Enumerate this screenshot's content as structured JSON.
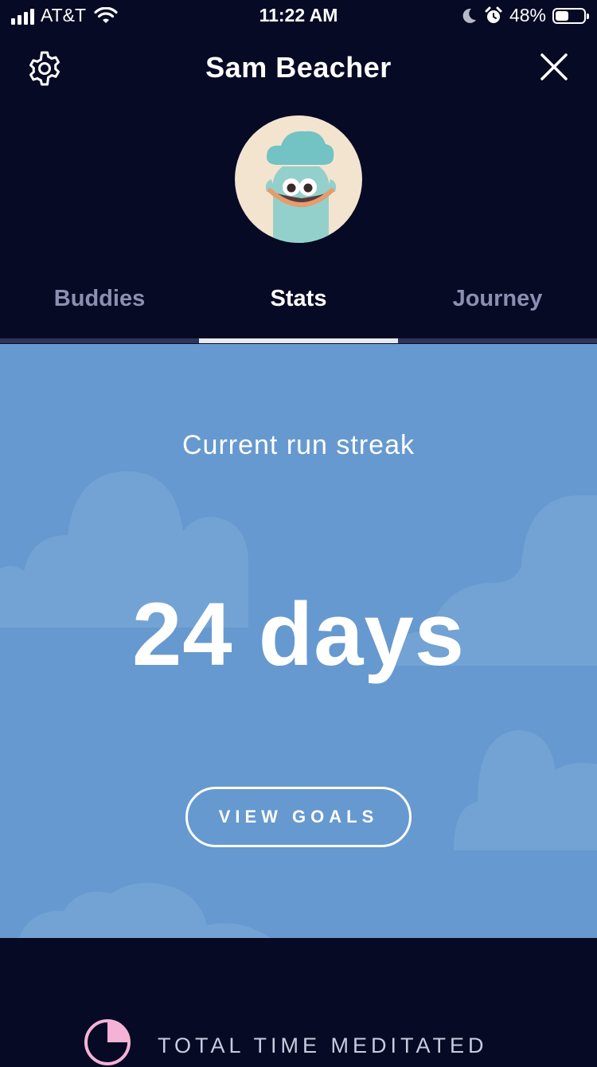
{
  "status_bar": {
    "carrier": "AT&T",
    "time": "11:22 AM",
    "battery_percent": "48%",
    "battery_level": 0.48,
    "icons": [
      "signal-icon",
      "wifi-icon",
      "moon-icon",
      "alarm-icon",
      "battery-icon"
    ]
  },
  "header": {
    "title": "Sam Beacher",
    "left_icon": "gear-icon",
    "right_icon": "close-icon"
  },
  "tabs": [
    {
      "label": "Buddies",
      "active": false
    },
    {
      "label": "Stats",
      "active": true
    },
    {
      "label": "Journey",
      "active": false
    }
  ],
  "stats": {
    "streak_label": "Current run streak",
    "streak_value": "24 days",
    "view_goals_label": "VIEW GOALS"
  },
  "bottom": {
    "total_label": "TOTAL TIME MEDITATED"
  },
  "colors": {
    "background": "#070a24",
    "panel": "#6699cf",
    "tab_inactive": "#8c8fb1",
    "accent_pink": "#f4b3d6"
  }
}
